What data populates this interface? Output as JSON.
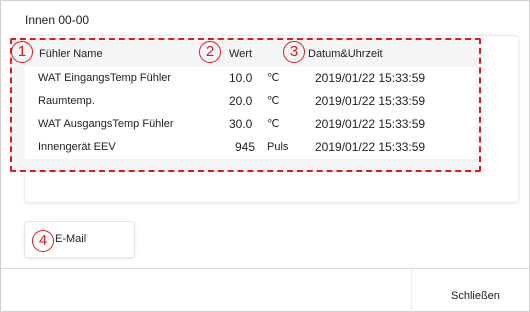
{
  "window": {
    "title": "Innen 00-00"
  },
  "table": {
    "headers": {
      "name": "Fühler Name",
      "value": "Wert",
      "datetime": "Datum&Uhrzeit"
    },
    "rows": [
      {
        "name": "WAT EingangsTemp Fühler",
        "value": "10.0",
        "unit": "℃",
        "datetime": "2019/01/22 15:33:59"
      },
      {
        "name": "Raumtemp.",
        "value": "20.0",
        "unit": "℃",
        "datetime": "2019/01/22 15:33:59"
      },
      {
        "name": "WAT AusgangsTemp Fühler",
        "value": "30.0",
        "unit": "℃",
        "datetime": "2019/01/22 15:33:59"
      },
      {
        "name": "Innengerät EEV",
        "value": "945",
        "unit": "Puls",
        "datetime": "2019/01/22 15:33:59"
      }
    ]
  },
  "annotations": {
    "one": "1",
    "two": "2",
    "three": "3",
    "four": "4",
    "color": "#e0191e"
  },
  "actions": {
    "email_label": "E-Mail",
    "close_label": "Schließen"
  }
}
